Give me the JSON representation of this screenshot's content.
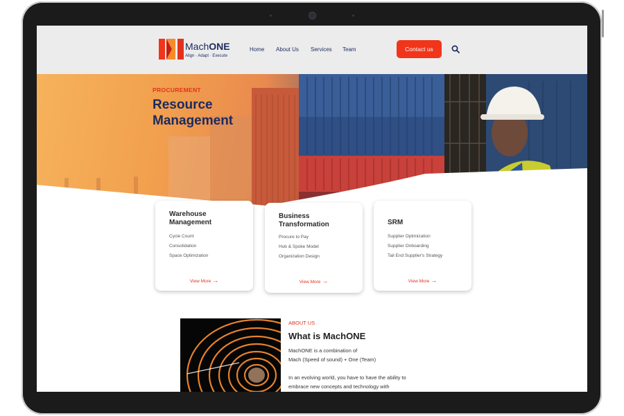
{
  "brand": {
    "name_part1": "Mach",
    "name_part2": "ONE",
    "tagline": "Align · Adapt · Execute",
    "colors": {
      "primary": "#1b2a5e",
      "accent": "#f0351b"
    }
  },
  "nav": {
    "items": [
      "Home",
      "About Us",
      "Services",
      "Team"
    ],
    "contact_label": "Contact us",
    "search_icon": "search-icon"
  },
  "hero": {
    "eyebrow": "PROCUREMENT",
    "title": "Resource Management"
  },
  "cards": [
    {
      "title": "Warehouse Management",
      "items": [
        "Cycle Count",
        "Consolidation",
        "Space Optimization"
      ],
      "link": "View More"
    },
    {
      "title": "Business Transformation",
      "items": [
        "Procure to Pay",
        "Hub & Spoke Model",
        "Organization Design"
      ],
      "link": "View More"
    },
    {
      "title": "SRM",
      "items": [
        "Supplier Optimization",
        "Supplier Onboarding",
        "Tail End Supplier's Strategy"
      ],
      "link": "View More"
    }
  ],
  "about": {
    "eyebrow": "ABOUT US",
    "title": "What is MachONE",
    "line1": "MachONE is a combination of",
    "line2": "Mach (Speed of sound) + One (Team)",
    "line3": "In an evolving world, you have to have the ability to",
    "line4": "embrace new concepts and technology with"
  }
}
